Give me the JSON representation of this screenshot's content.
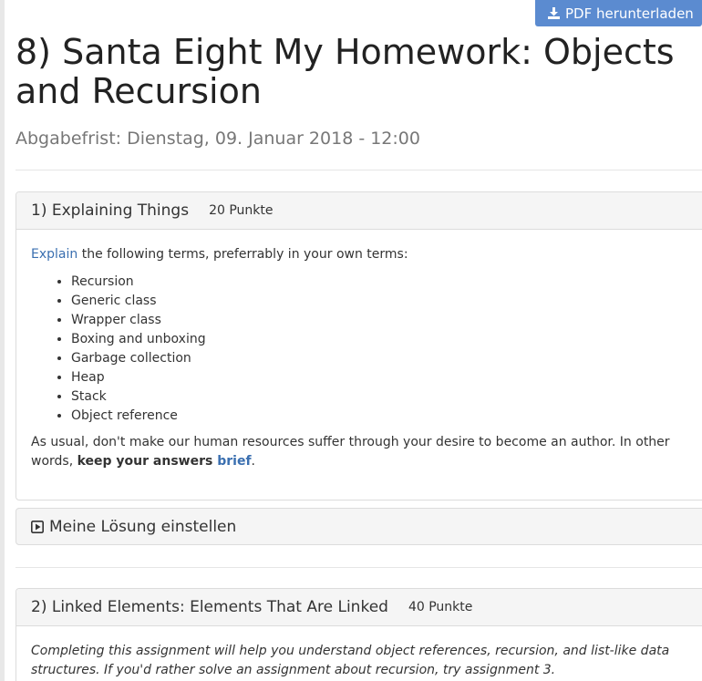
{
  "toolbar": {
    "pdf_label": "PDF herunterladen"
  },
  "assignment": {
    "title": "8) Santa Eight My Homework: Objects and Recursion",
    "deadline": "Abgabefrist: Dienstag, 09. Januar 2018 - 12:00"
  },
  "task1": {
    "title": "1) Explaining Things",
    "points": "20 Punkte",
    "intro_link": "Explain",
    "intro_rest": " the following terms, preferrably in your own terms:",
    "terms": [
      "Recursion",
      "Generic class",
      "Wrapper class",
      "Boxing and unboxing",
      "Garbage collection",
      "Heap",
      "Stack",
      "Object reference"
    ],
    "outro_start": "As usual, don't make our human resources suffer through your desire to become an author. In other words, ",
    "outro_bold": "keep your answers ",
    "outro_link": "brief",
    "outro_end": "."
  },
  "submission": {
    "label": "Meine Lösung einstellen"
  },
  "task2": {
    "title": "2) Linked Elements: Elements That Are Linked",
    "points": "40 Punkte",
    "description": "Completing this assignment will help you understand object references, recursion, and list-like data structures. If you'd rather solve an assignment about recursion, try assignment 3."
  },
  "colors": {
    "accent": "#5b8bd0",
    "link": "#3a6fb0",
    "panel_heading_bg": "#f5f5f5"
  },
  "icons": {
    "pdf_button": "download-icon",
    "submission": "play-square-icon"
  }
}
